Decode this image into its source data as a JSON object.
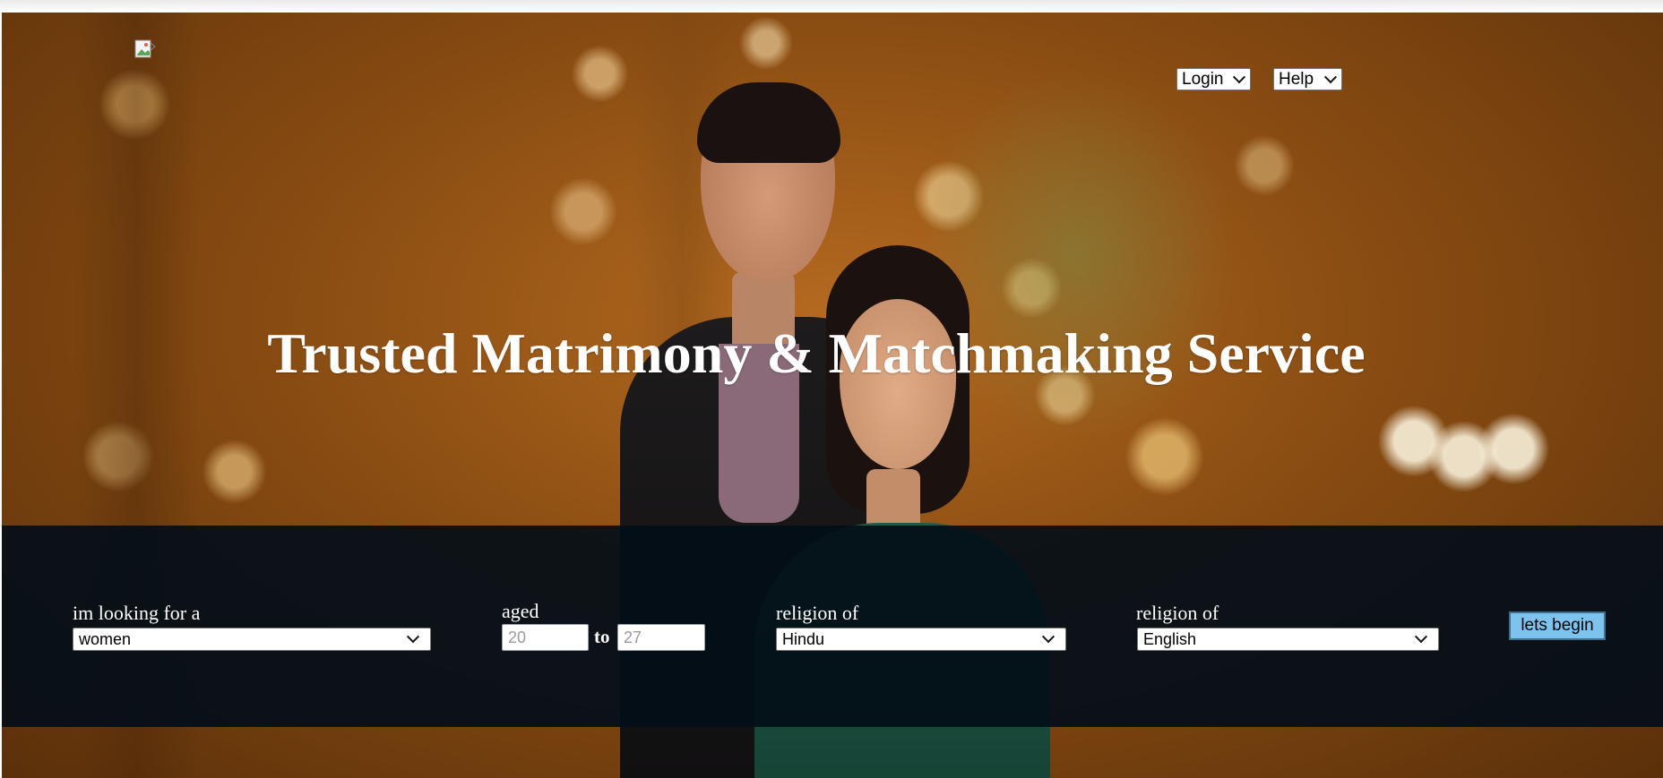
{
  "header": {
    "logo_icon": "broken-image-icon",
    "nav": [
      {
        "label": "Login",
        "icon": "chevron-down-icon"
      },
      {
        "label": "Help",
        "icon": "chevron-down-icon"
      }
    ]
  },
  "hero": {
    "headline": "Trusted Matrimony & Matchmaking Service"
  },
  "search": {
    "looking_for": {
      "label": "im looking for a",
      "value": "women"
    },
    "aged": {
      "label": "aged",
      "from_placeholder": "20",
      "to_label": "to",
      "to_placeholder": "27"
    },
    "religion": {
      "label": "religion of",
      "value": "Hindu"
    },
    "language": {
      "label": "religion of",
      "value": "English"
    },
    "submit_label": "lets begin"
  },
  "colors": {
    "search_band": "#030e18",
    "button": "#7cc4ee",
    "headline": "#ffffff"
  }
}
